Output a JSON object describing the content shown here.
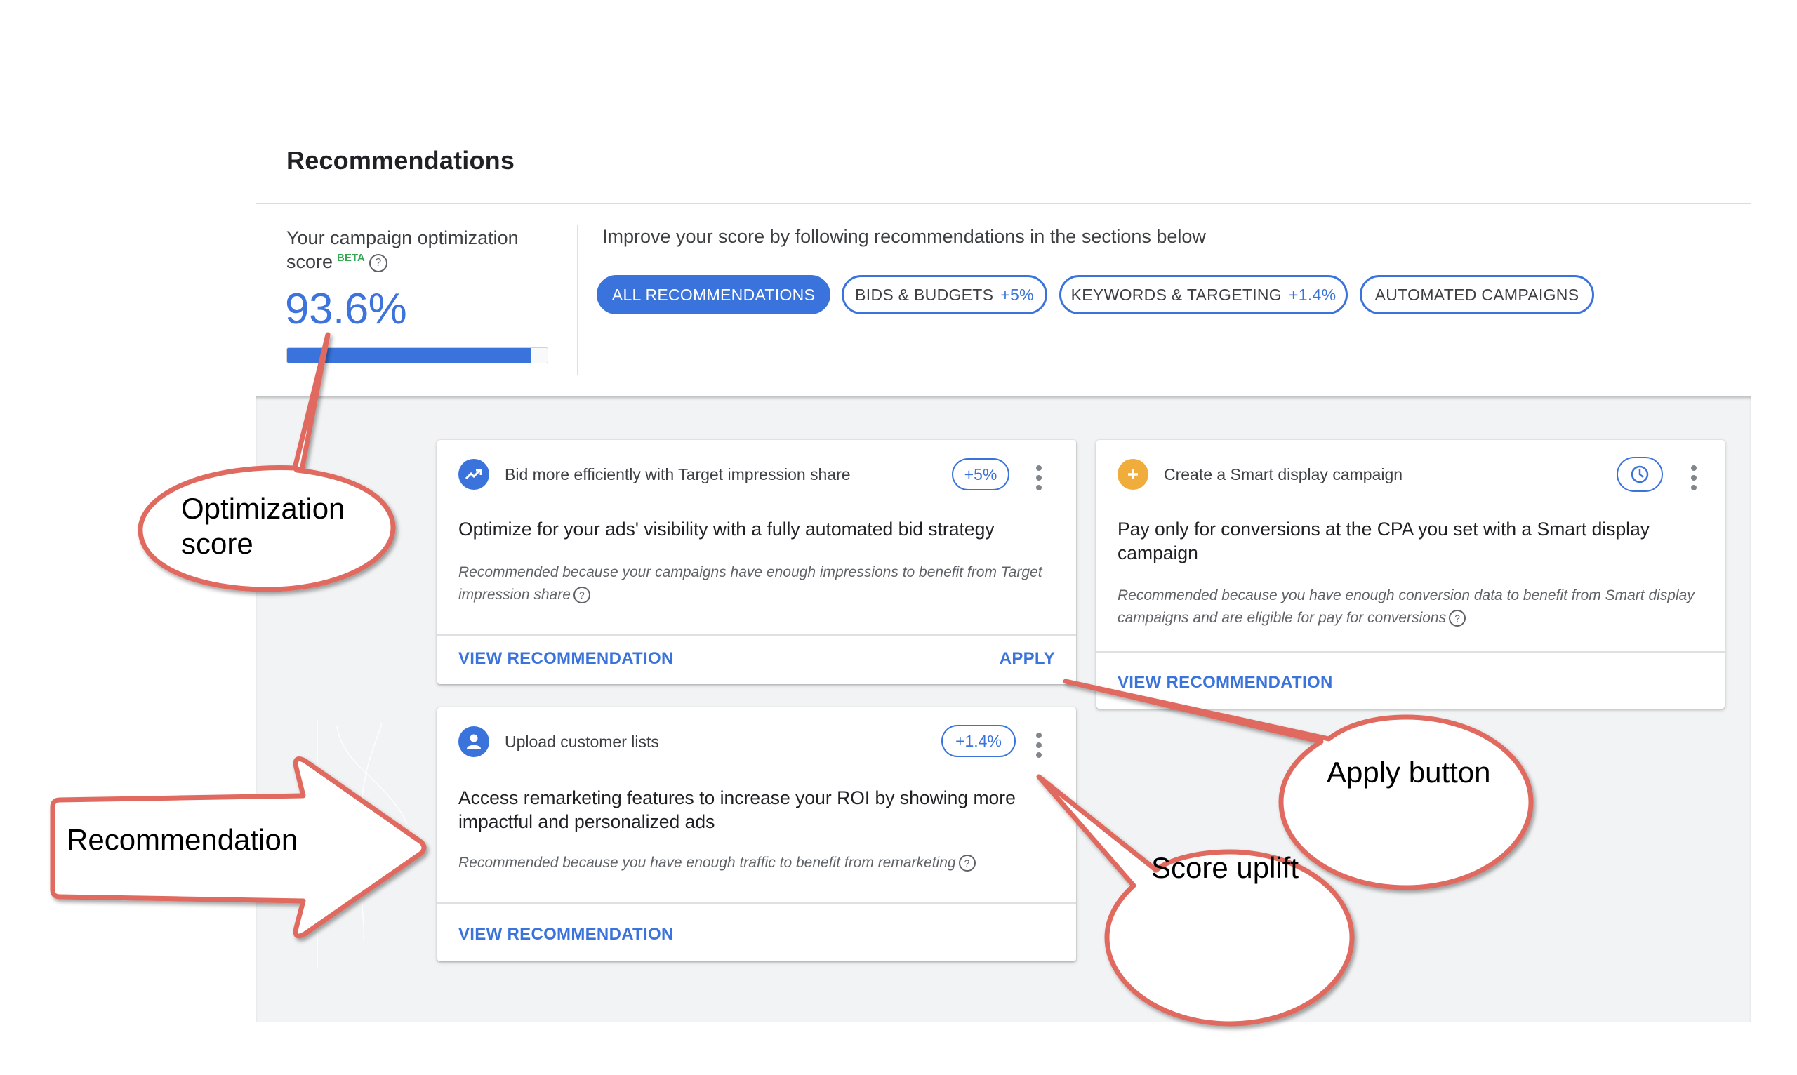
{
  "header": {
    "title": "Recommendations"
  },
  "score_panel": {
    "label": "Your campaign optimization score",
    "beta_badge": "BETA",
    "help_icon": "help-circle-icon",
    "score_value": "93.6%",
    "progress_fraction": 0.936
  },
  "filters": {
    "intro_text": "Improve your score by following recommendations in the sections below",
    "chips": [
      {
        "label": "ALL RECOMMENDATIONS",
        "uplift": "",
        "active": true
      },
      {
        "label": "BIDS & BUDGETS",
        "uplift": "+5%",
        "active": false
      },
      {
        "label": "KEYWORDS & TARGETING",
        "uplift": "+1.4%",
        "active": false
      },
      {
        "label": "AUTOMATED CAMPAIGNS",
        "uplift": "",
        "active": false
      }
    ]
  },
  "cards": [
    {
      "icon": "trending-up-icon",
      "icon_color": "#3a73dc",
      "category": "Bid more efficiently with Target impression share",
      "uplift": "+5%",
      "headline": "Optimize for your ads' visibility with a fully automated bid strategy",
      "reason": "Recommended because your campaigns have enough impressions to benefit from Target impression share",
      "primary_action": "VIEW RECOMMENDATION",
      "secondary_action": "APPLY"
    },
    {
      "icon": "plus-icon",
      "icon_color": "#f0ad3c",
      "category": "Create a Smart display campaign",
      "uplift_icon": "clock-icon",
      "headline": "Pay only for conversions at the CPA you set with a Smart display campaign",
      "reason": "Recommended because you have enough conversion data to benefit from Smart display campaigns and are eligible for pay for conversions",
      "primary_action": "VIEW RECOMMENDATION"
    },
    {
      "icon": "person-icon",
      "icon_color": "#3a73dc",
      "category": "Upload customer lists",
      "uplift": "+1.4%",
      "headline": "Access remarketing features to increase your ROI by showing more impactful and personalized ads",
      "reason": "Recommended because you have enough traffic to benefit from remarketing",
      "primary_action": "VIEW RECOMMENDATION"
    }
  ],
  "annotations": {
    "optimization_score": "Optimization score",
    "recommendation": "Recommendation",
    "apply_button": "Apply button",
    "score_uplift": "Score uplift",
    "color": "#e06b5e"
  },
  "colors": {
    "accent": "#3a73dc",
    "background_gray": "#f1f3f4",
    "beta_green": "#34a853"
  }
}
